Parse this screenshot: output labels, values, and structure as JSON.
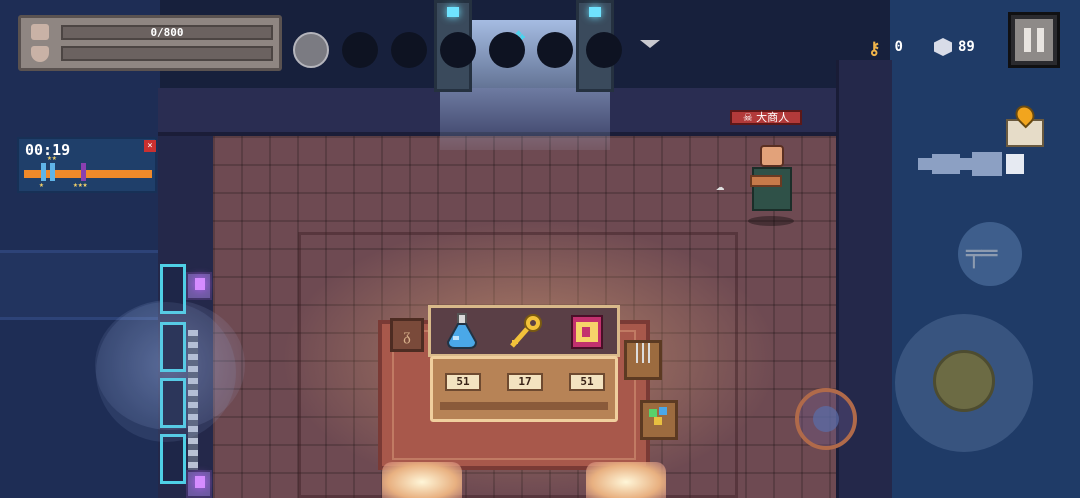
{
  "hud": {
    "health_text": "0/800",
    "keys_count": "0",
    "gems_count": "89",
    "weapon_slots": [
      "slot1",
      "slot2",
      "slot3",
      "slot4",
      "slot5",
      "slot6",
      "slot7"
    ],
    "active_slot_index": 0
  },
  "timer": {
    "time": "00:19",
    "close_label": "×",
    "star_low": "★",
    "star_mid": "★★",
    "star_high": "★★★"
  },
  "merchant": {
    "name": "大商人"
  },
  "shop": {
    "items": [
      {
        "name": "blue-potion",
        "price": "51"
      },
      {
        "name": "golden-key",
        "price": "17"
      },
      {
        "name": "spell-book",
        "price": "51"
      }
    ],
    "bag_glyph": "ᵹ"
  },
  "colors": {
    "accent_orange": "#f08a2a",
    "npc_tag_red": "#b23a3a",
    "portal_cyan": "#48d7f0"
  }
}
